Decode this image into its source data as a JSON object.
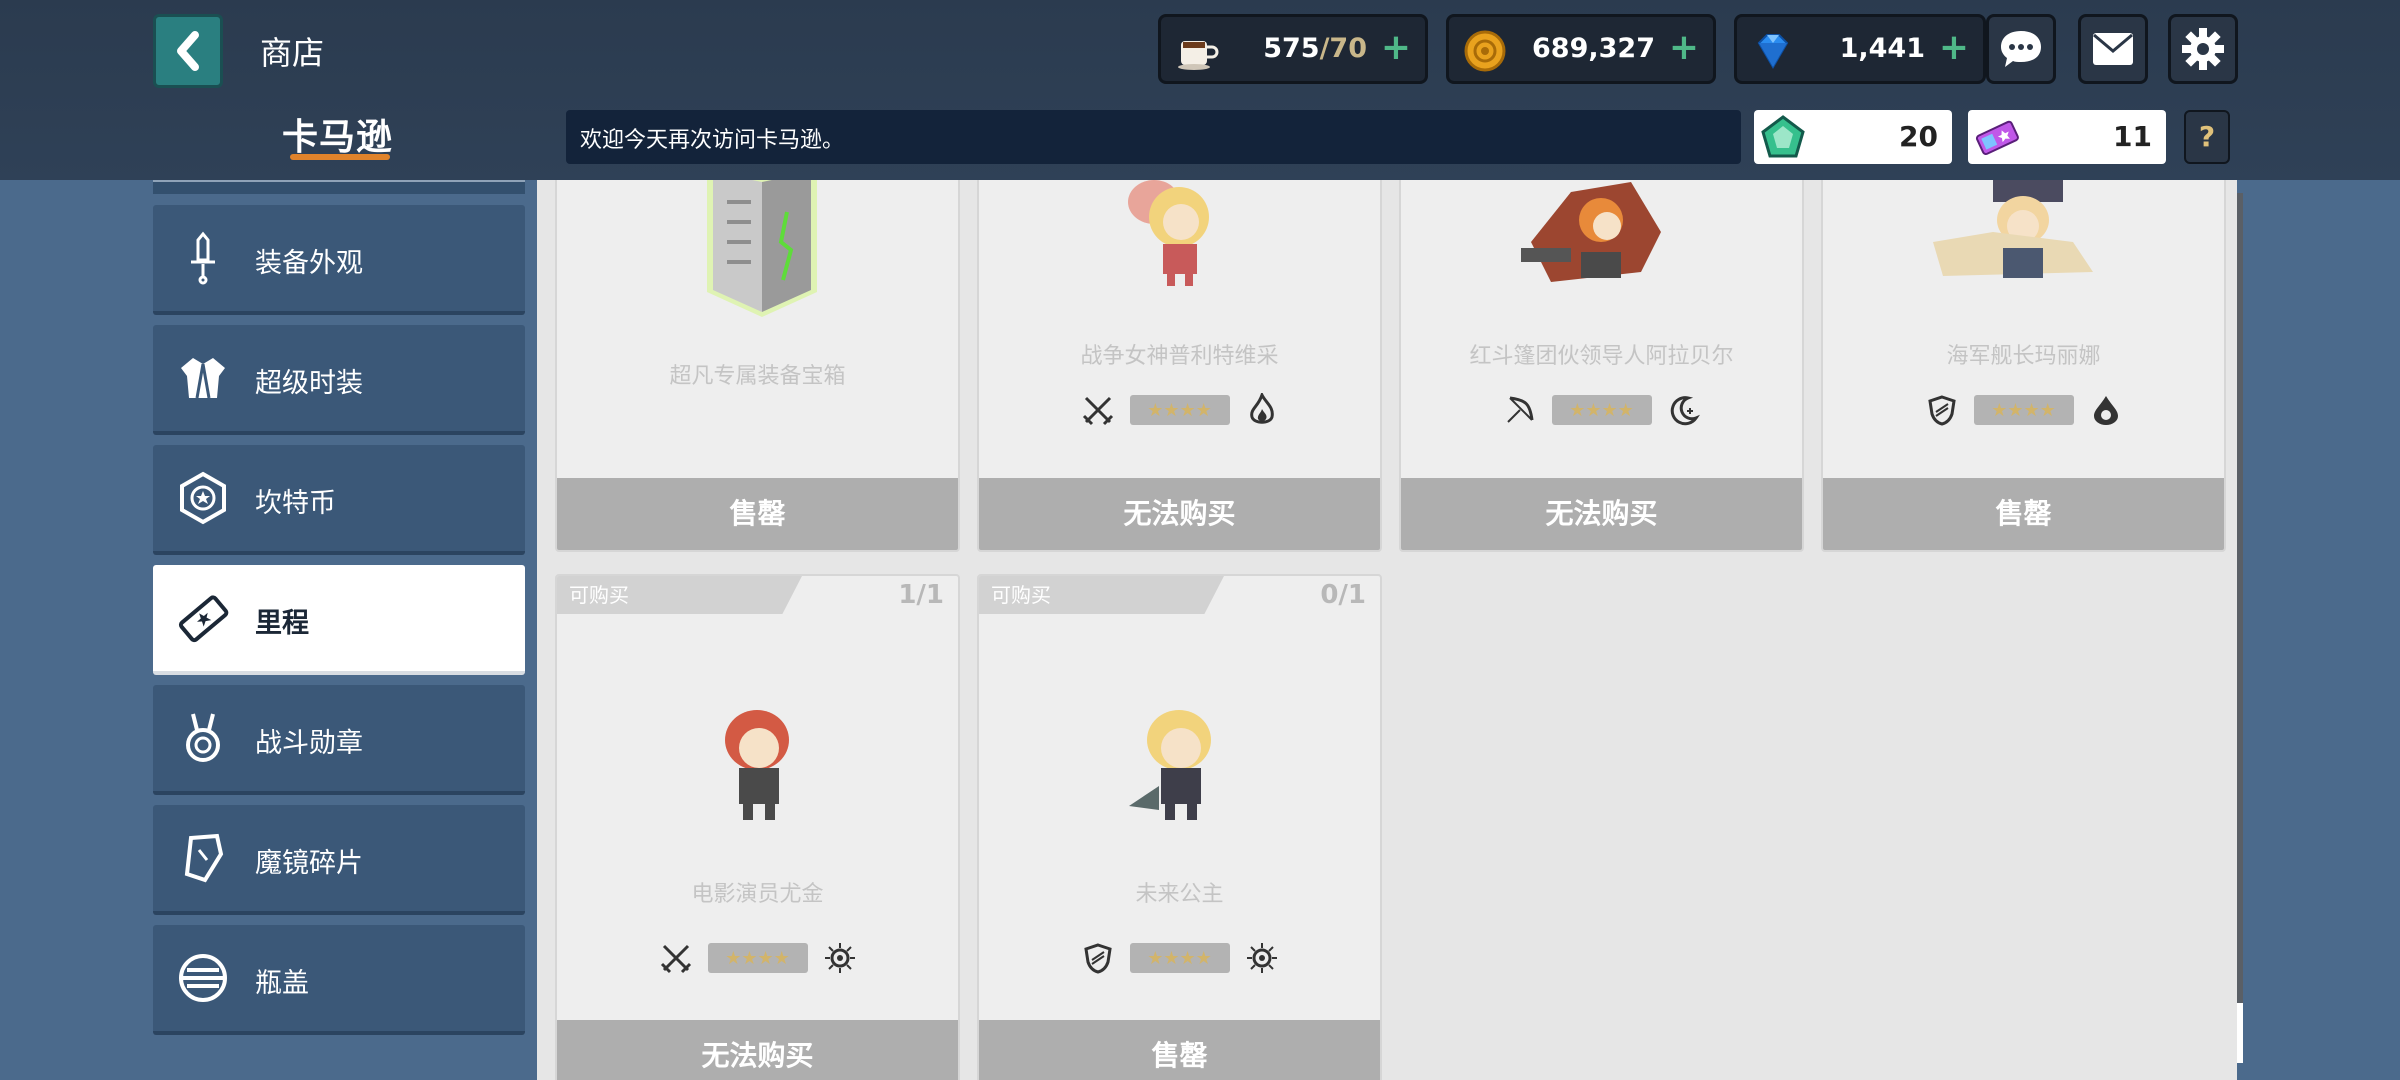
{
  "header": {
    "title": "商店",
    "brand": "卡马逊",
    "welcome": "欢迎今天再次访问卡马逊。",
    "stamina": {
      "current": "575",
      "max": "/70"
    },
    "gold": "689,327",
    "gems": "1,441",
    "token_a": "20",
    "token_b": "11",
    "help": "?"
  },
  "sidebar": {
    "items": [
      {
        "label": "装备外观",
        "icon": "sword-icon"
      },
      {
        "label": "超级时装",
        "icon": "costume-icon"
      },
      {
        "label": "坎特币",
        "icon": "coin-hexagon-icon"
      },
      {
        "label": "里程",
        "icon": "ticket-star-icon",
        "active": true
      },
      {
        "label": "战斗勋章",
        "icon": "medal-icon"
      },
      {
        "label": "魔镜碎片",
        "icon": "mirror-shard-icon"
      },
      {
        "label": "瓶盖",
        "icon": "bottle-cap-icon"
      }
    ]
  },
  "cards": [
    {
      "name": "超凡专属装备宝箱",
      "button": "售罄"
    },
    {
      "name": "战争女神普利特维采",
      "button": "无法购买",
      "role": "sword",
      "element": "fire"
    },
    {
      "name": "红斗篷团伙领导人阿拉贝尔",
      "button": "无法购买",
      "role": "bow",
      "element": "moon"
    },
    {
      "name": "海军舰长玛丽娜",
      "button": "售罄",
      "role": "shield",
      "element": "water"
    },
    {
      "name": "电影演员尤金",
      "button": "无法购买",
      "tag": "可购买",
      "limit": "1/1",
      "role": "sword",
      "element": "light"
    },
    {
      "name": "未来公主",
      "button": "售罄",
      "tag": "可购买",
      "limit": "0/1",
      "role": "shield",
      "element": "light"
    }
  ],
  "stars": "★★★★",
  "colors": {
    "accent": "#2a7f80",
    "plus": "#4fb888",
    "underline": "#e0832b"
  }
}
